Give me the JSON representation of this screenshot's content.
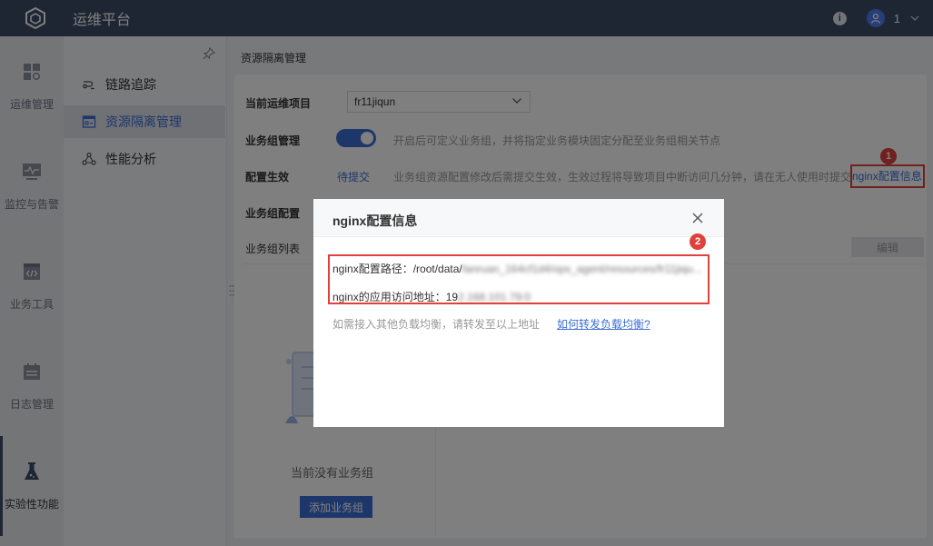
{
  "app": {
    "title": "运维平台",
    "user_number": "1"
  },
  "rail": {
    "items": [
      {
        "label": "运维管理",
        "icon": "grid-icon"
      },
      {
        "label": "监控与告警",
        "icon": "monitor-icon"
      },
      {
        "label": "业务工具",
        "icon": "code-icon"
      },
      {
        "label": "日志管理",
        "icon": "calendar-icon"
      },
      {
        "label": "实验性功能",
        "icon": "flask-icon"
      }
    ],
    "active_index": 4
  },
  "subnav": {
    "items": [
      {
        "label": "链路追踪",
        "icon": "link-icon"
      },
      {
        "label": "资源隔离管理",
        "icon": "resource-icon"
      },
      {
        "label": "性能分析",
        "icon": "performance-icon"
      }
    ],
    "active_index": 1
  },
  "main": {
    "title": "资源隔离管理",
    "project_label": "当前运维项目",
    "project_value": "fr11jiqun",
    "group_mgmt_label": "业务组管理",
    "group_mgmt_hint": "开启后可定义业务组，并将指定业务模块固定分配至业务组相关节点",
    "config_label": "配置生效",
    "config_status": "待提交",
    "config_hint": "业务组资源配置修改后需提交生效，生效过程将导致项目中断访问几分钟，请在无人使用时提交",
    "nginx_link": "nginx配置信息",
    "group_config_label": "业务组配置",
    "group_list_label": "业务组列表",
    "edit_button": "编辑",
    "empty_text": "当前没有业务组",
    "add_button": "添加业务组"
  },
  "badges": {
    "one": "1",
    "two": "2"
  },
  "modal": {
    "title": "nginx配置信息",
    "path_label": "nginx配置路径：/root/data/",
    "path_blurred": "fanruan_164cf1d4/ops_agent/resources/fr11jiqu...",
    "address_label": "nginx的应用访问地址：19",
    "address_blurred": "2.168.101.79:0",
    "hint": "如需接入其他负载均衡，请转发至以上地址",
    "help_link": "如何转发负载均衡?"
  },
  "colors": {
    "topbar": "#3d4a66",
    "accent": "#3d6fd6",
    "highlight": "#e0413a"
  }
}
